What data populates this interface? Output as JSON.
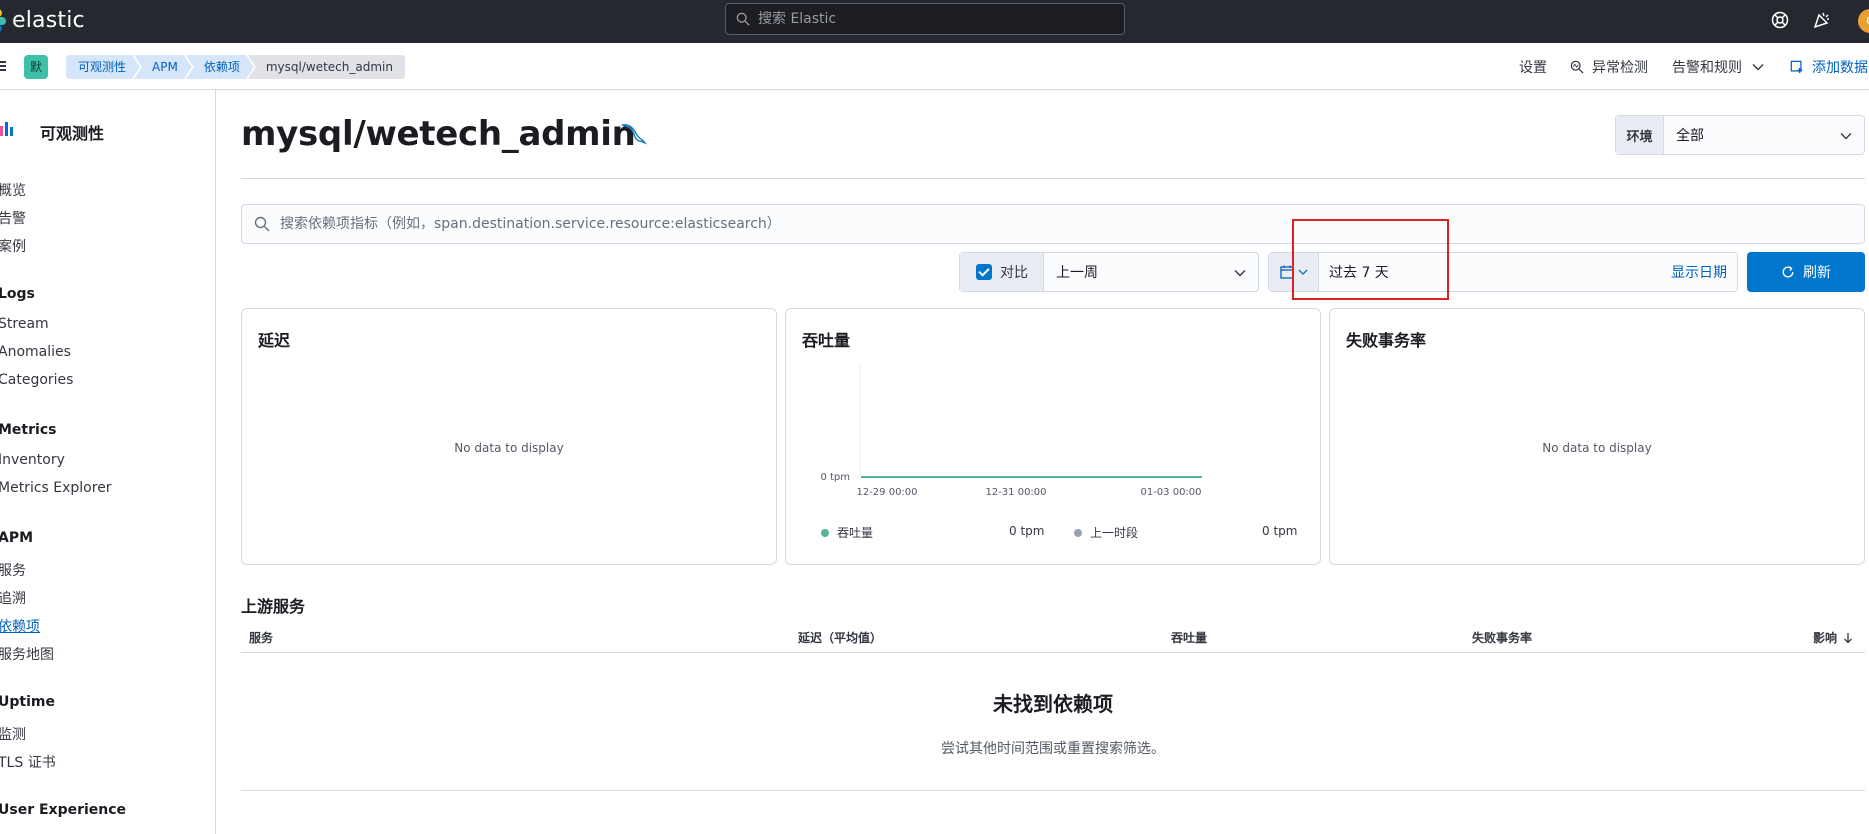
{
  "header": {
    "logo_text": "elastic",
    "search_placeholder": "搜索 Elastic",
    "avatar_letter": "e"
  },
  "subheader": {
    "space_badge": "默",
    "breadcrumbs": [
      "可观测性",
      "APM",
      "依赖项",
      "mysql/wetech_admin"
    ],
    "links": {
      "settings": "设置",
      "anomaly": "异常检测",
      "alerts": "告警和规则",
      "add_data": "添加数据"
    }
  },
  "sidenav": {
    "title": "可观测性",
    "top_items": [
      "概览",
      "告警",
      "案例"
    ],
    "sections": [
      {
        "heading": "Logs",
        "items": [
          "Stream",
          "Anomalies",
          "Categories"
        ]
      },
      {
        "heading": "Metrics",
        "items": [
          "Inventory",
          "Metrics Explorer"
        ]
      },
      {
        "heading": "APM",
        "items": [
          "服务",
          "追溯",
          "依赖项",
          "服务地图"
        ]
      },
      {
        "heading": "Uptime",
        "items": [
          "监测",
          "TLS 证书"
        ]
      },
      {
        "heading": "User Experience",
        "items": []
      }
    ],
    "active_item": "依赖项"
  },
  "main": {
    "title": "mysql/wetech_admin",
    "environment": {
      "label": "环境",
      "value": "全部"
    },
    "kql_placeholder": "搜索依赖项指标（例如，span.destination.service.resource:elasticsearch）",
    "comparison": {
      "label": "对比",
      "checked": true,
      "value": "上一周"
    },
    "date": {
      "value": "过去 7 天",
      "show_dates": "显示日期"
    },
    "refresh_label": "刷新"
  },
  "panels": {
    "latency": {
      "title": "延迟",
      "empty": "No data to display"
    },
    "throughput": {
      "title": "吞吐量"
    },
    "failed": {
      "title": "失败事务率",
      "empty": "No data to display"
    }
  },
  "chart_data": {
    "type": "line",
    "title": "吞吐量",
    "x_ticks": [
      "12-29 00:00",
      "12-31 00:00",
      "01-03 00:00"
    ],
    "y_ticks": [
      "0 tpm"
    ],
    "series": [
      {
        "name": "吞吐量",
        "color": "#54b399",
        "summary": "0 tpm",
        "values": [
          0,
          0,
          0,
          0,
          0,
          0,
          0,
          0
        ]
      },
      {
        "name": "上一时段",
        "color": "#98a2b3",
        "summary": "0 tpm",
        "values": []
      }
    ],
    "ylim": [
      0,
      0
    ]
  },
  "upstream": {
    "title": "上游服务",
    "columns": [
      "服务",
      "延迟（平均值）",
      "吞吐量",
      "失败事务率",
      "影响"
    ],
    "empty_title": "未找到依赖项",
    "empty_body": "尝试其他时间范围或重置搜索筛选。"
  },
  "colors": {
    "primary": "#0077cc",
    "highlight": "#e02020",
    "series": "#54b399"
  }
}
